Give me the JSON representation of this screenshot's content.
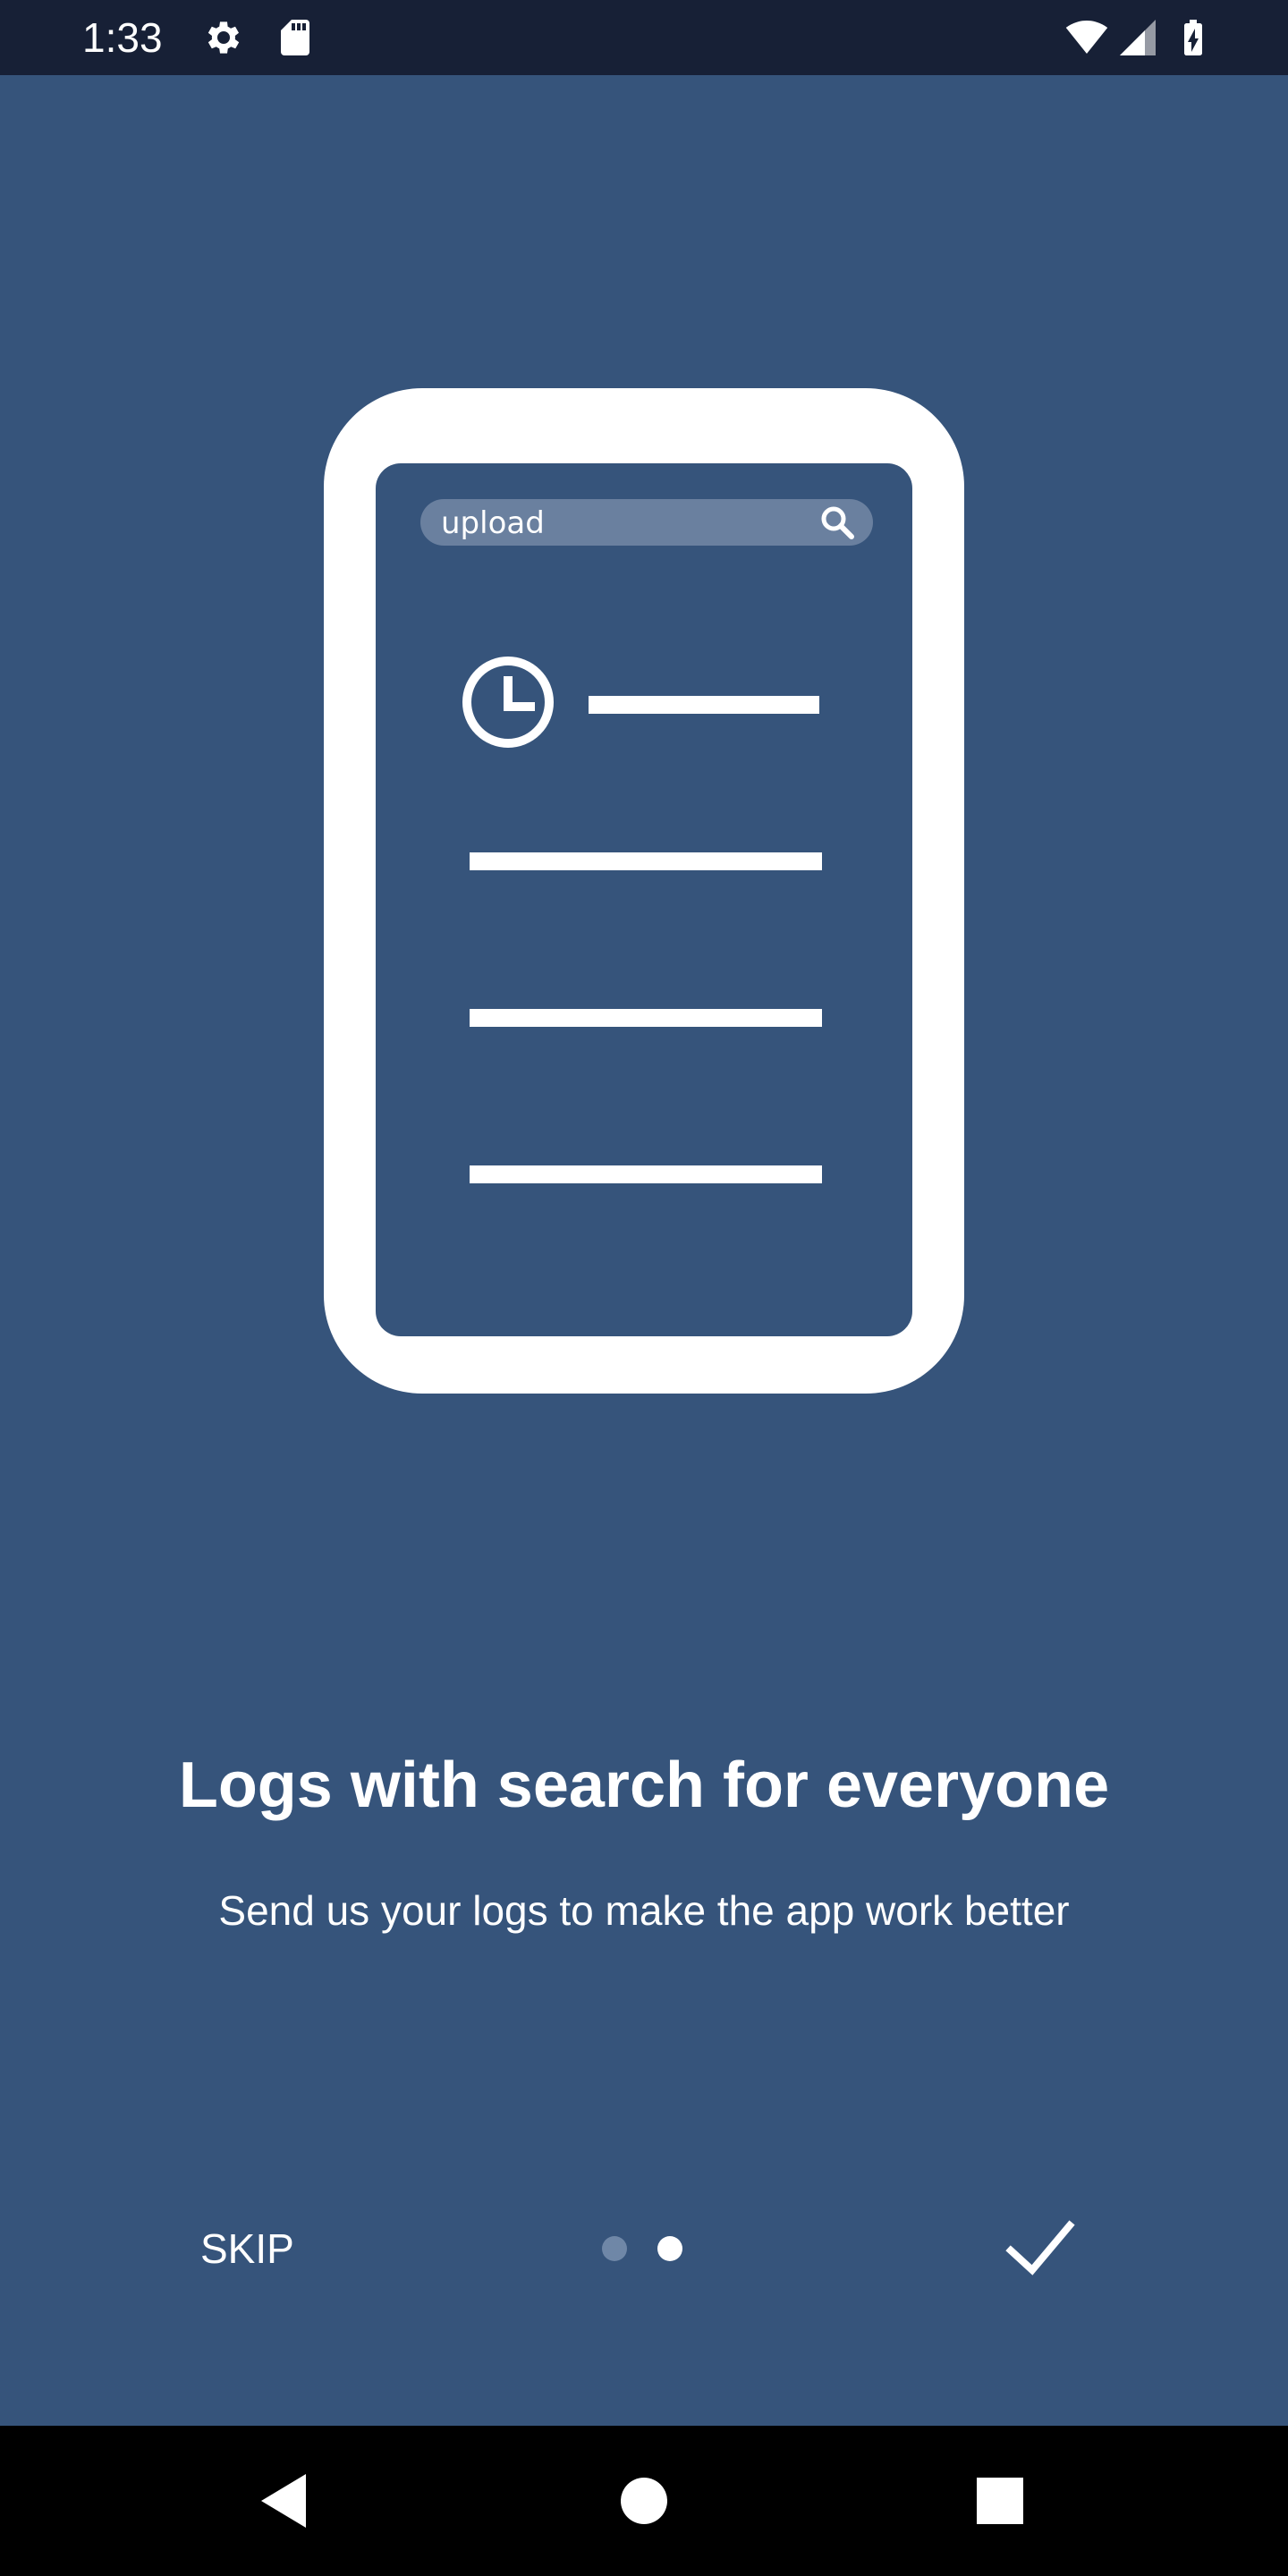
{
  "status_bar": {
    "time": "1:33",
    "icons": [
      "settings-gear",
      "sd-card",
      "wifi",
      "cell-signal",
      "battery-charging"
    ]
  },
  "illustration": {
    "search_text": "upload"
  },
  "onboarding": {
    "title": "Logs with search for everyone",
    "subtitle": "Send us your logs to make the app work better",
    "skip_label": "SKIP",
    "page_indicator": {
      "total": 2,
      "current": 2
    },
    "done_icon": "check-icon"
  },
  "nav_bar": {
    "buttons": [
      "back",
      "home",
      "recents"
    ]
  },
  "colors": {
    "background": "#36547b",
    "status_bar": "#172036",
    "nav_bar": "#000000",
    "search_pill": "#6a809f",
    "inactive_dot": "#6f87a7",
    "foreground": "#ffffff"
  }
}
